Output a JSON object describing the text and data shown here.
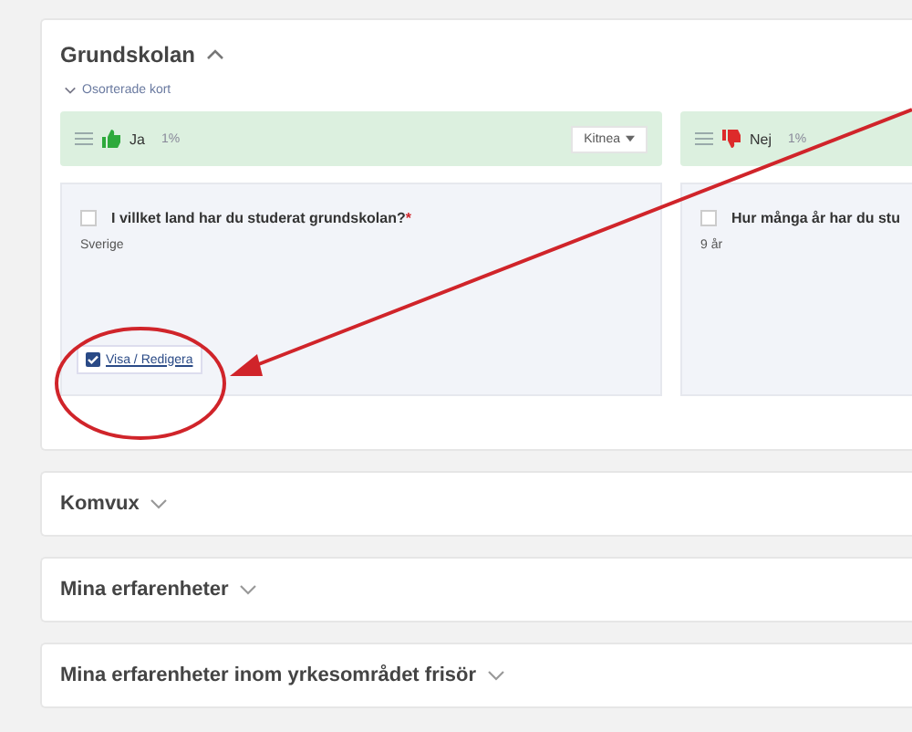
{
  "section": {
    "title": "Grundskolan",
    "expanded": true,
    "sort_toggle": "Osorterade kort",
    "cards": [
      {
        "kind": "yes",
        "answer": "Ja",
        "percent": "1%",
        "menu": "Kitnea",
        "question": "I villket land har du studerat grundskolan?",
        "checked": false,
        "required_mark": "*",
        "value": "Sverige",
        "link": "Visa / Redigera"
      },
      {
        "kind": "no",
        "answer": "Nej",
        "percent": "1%",
        "question": "Hur många år har du stu",
        "checked": false,
        "value": "9 år"
      }
    ]
  },
  "collapsed_sections": [
    {
      "title": "Komvux",
      "expanded": false
    },
    {
      "title": "Mina erfarenheter",
      "expanded": false
    },
    {
      "title": "Mina erfarenheter inom yrkesområdet frisör",
      "expanded": false
    }
  ]
}
